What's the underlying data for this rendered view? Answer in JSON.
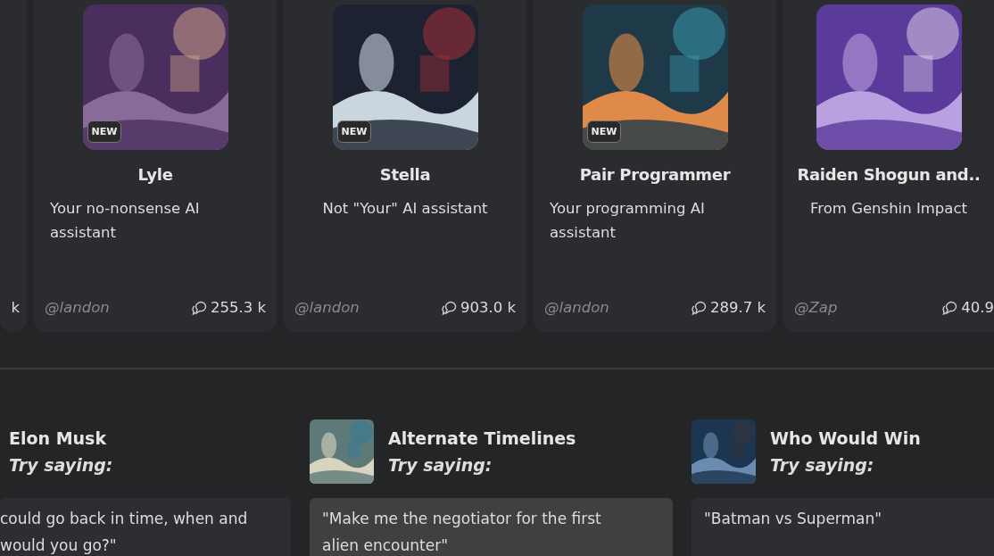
{
  "characters": [
    {
      "kind": "partial",
      "chats": "k"
    },
    {
      "kind": "card",
      "name": "Lyle",
      "description": "Your no-nonsense AI assistant",
      "handle": "@landon",
      "chats": "255.3 k",
      "new": true,
      "badge": "NEW"
    },
    {
      "kind": "card",
      "name": "Stella",
      "description": "Not \"Your\" AI assistant",
      "handle": "@landon",
      "chats": "903.0 k",
      "new": true,
      "badge": "NEW"
    },
    {
      "kind": "card",
      "name": "Pair Programmer",
      "description": "Your programming AI assistant",
      "handle": "@landon",
      "chats": "289.7 k",
      "new": true,
      "badge": "NEW"
    },
    {
      "kind": "card",
      "name": "Raiden Shogun and..",
      "description": "From Genshin Impact",
      "handle": "@Zap",
      "chats": "40.9",
      "new": false
    }
  ],
  "suggestions": [
    {
      "kind": "cut",
      "name": "Elon Musk",
      "hint": "Try saying:",
      "quote": "could go back in time, when and would you go?\"",
      "highlighted": false
    },
    {
      "kind": "full",
      "name": "Alternate Timelines",
      "hint": "Try saying:",
      "quote": "\"Make me the negotiator for the first alien encounter\"",
      "highlighted": true
    },
    {
      "kind": "full",
      "name": "Who Would Win",
      "hint": "Try saying:",
      "quote": "\"Batman vs Superman\"",
      "highlighted": false
    }
  ]
}
